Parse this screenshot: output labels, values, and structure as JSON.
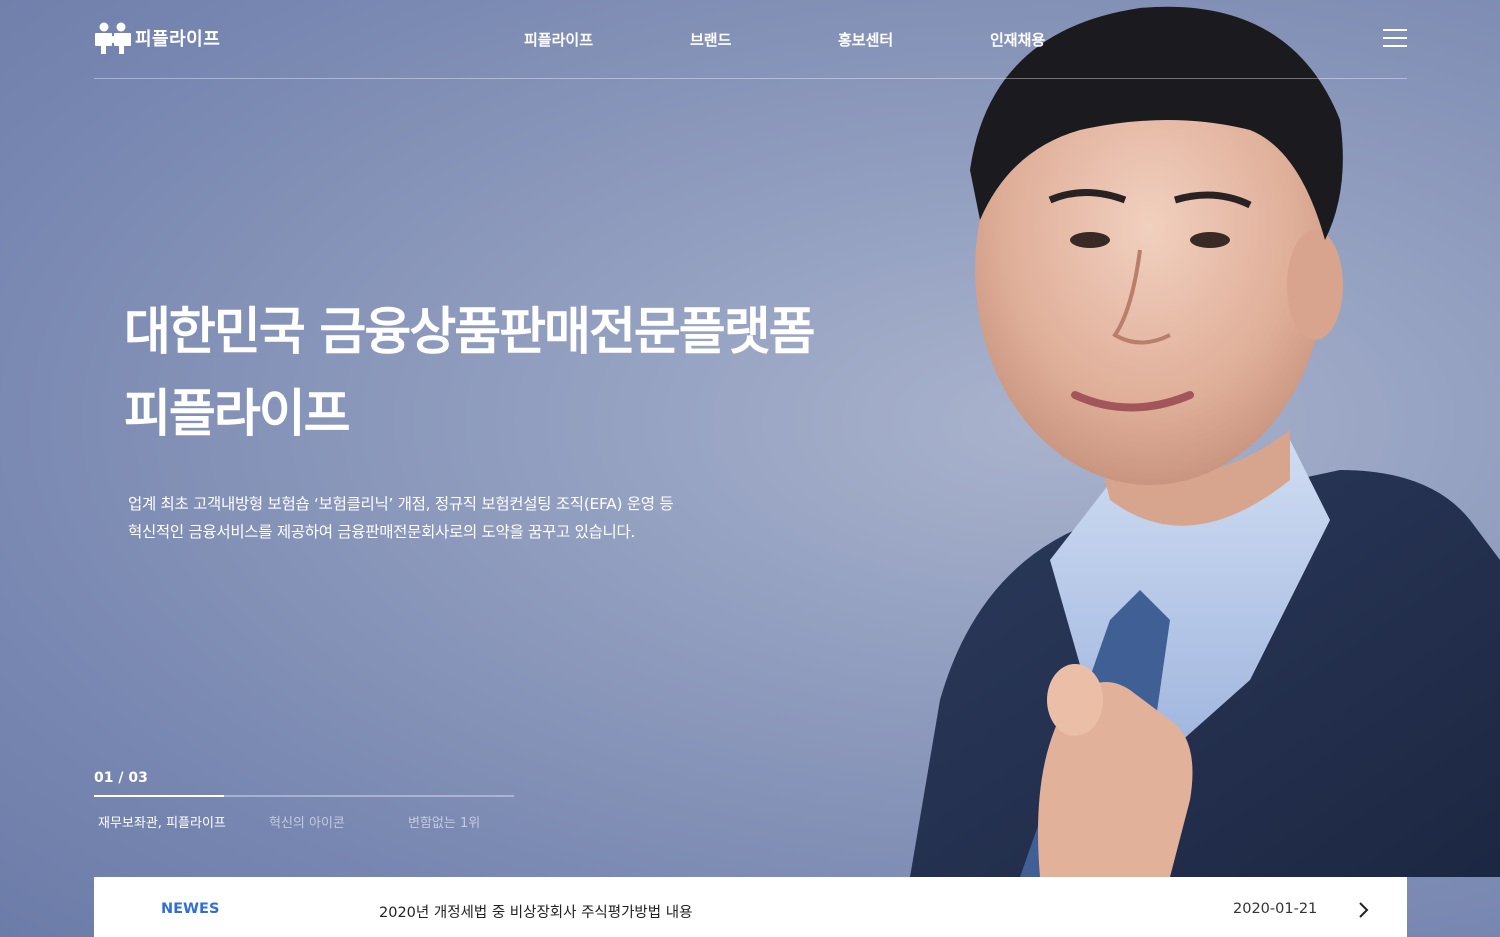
{
  "brand": {
    "logo_text": "피플라이프",
    "logo_icon": "people-puzzle-logo-icon"
  },
  "nav": {
    "items": [
      {
        "label": "피플라이프"
      },
      {
        "label": "브랜드"
      },
      {
        "label": "홍보센터"
      },
      {
        "label": "인재채용"
      }
    ],
    "menu_icon": "hamburger-menu-icon"
  },
  "hero": {
    "title_line1": "대한민국 금융상품판매전문플랫폼",
    "title_line2": "피플라이프",
    "desc_line1": "업계 최초 고객내방형 보험숍 ‘보험클리닉’ 개점, 정규직 보험컨설팅 조직(EFA) 운영 등",
    "desc_line2": "혁신적인 금융서비스를 제공하여 금융판매전문회사로의 도약을 꿈꾸고 있습니다."
  },
  "slider": {
    "counter": "01 / 03",
    "progress": 0.31,
    "tabs": [
      {
        "label": "재무보좌관, 피플라이프",
        "active": true
      },
      {
        "label": "혁신의 아이콘",
        "active": false
      },
      {
        "label": "변함없는 1위",
        "active": false
      }
    ]
  },
  "news": {
    "label": "NEWES",
    "headline": "2020년 개정세법 중 비상장회사 주식평가방법 내용",
    "date": "2020-01-21",
    "arrow_icon": "chevron-right-icon"
  },
  "colors": {
    "background": "#8e9bbd",
    "accent_blue": "#2f6fd6",
    "news_bg": "#ffffff"
  }
}
